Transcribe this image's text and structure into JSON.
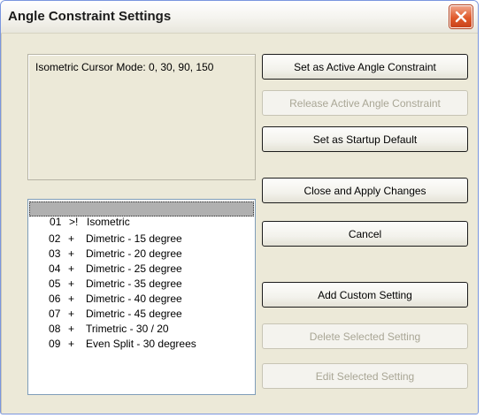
{
  "window": {
    "title": "Angle Constraint Settings"
  },
  "info": {
    "text": "Isometric Cursor Mode: 0, 30, 90, 150"
  },
  "list": {
    "items": [
      {
        "num": "01",
        "mark": ">!",
        "label": "Isometric",
        "selected": true
      },
      {
        "num": "02",
        "mark": "+",
        "label": "Dimetric - 15 degree"
      },
      {
        "num": "03",
        "mark": "+",
        "label": "Dimetric - 20 degree"
      },
      {
        "num": "04",
        "mark": "+",
        "label": "Dimetric - 25 degree"
      },
      {
        "num": "05",
        "mark": "+",
        "label": "Dimetric - 35 degree"
      },
      {
        "num": "06",
        "mark": "+",
        "label": "Dimetric - 40 degree"
      },
      {
        "num": "07",
        "mark": "+",
        "label": "Dimetric - 45 degree"
      },
      {
        "num": "08",
        "mark": "+",
        "label": "Trimetric - 30 / 20"
      },
      {
        "num": "09",
        "mark": "+",
        "label": "Even Split - 30 degrees"
      }
    ]
  },
  "buttons": {
    "set_active": "Set as Active Angle Constraint",
    "release_active": "Release Active Angle Constraint",
    "set_startup": "Set as Startup Default",
    "close_apply": "Close and Apply Changes",
    "cancel": "Cancel",
    "add_custom": "Add Custom Setting",
    "delete_selected": "Delete Selected Setting",
    "edit_selected": "Edit Selected Setting"
  },
  "icons": {
    "close": "close-icon"
  },
  "colors": {
    "close_button": "#e05a2b",
    "disabled_text": "#a9a695",
    "list_selection": "#b0b0b0"
  }
}
